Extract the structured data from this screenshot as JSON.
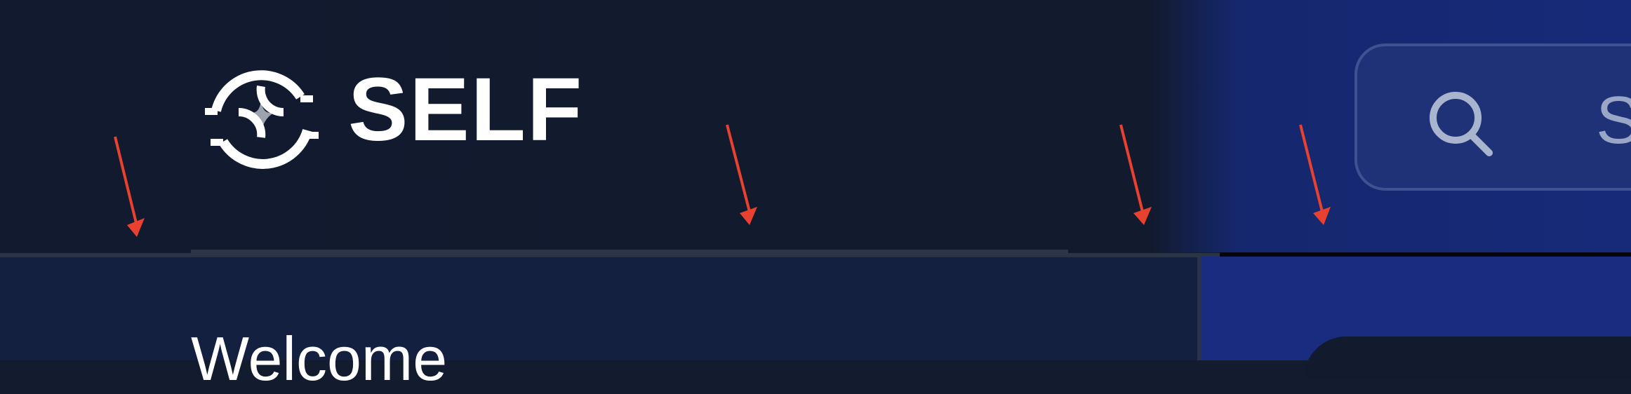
{
  "header": {
    "brand": "SELF",
    "search": {
      "placeholder": "S"
    }
  },
  "main": {
    "welcome": "Welcome"
  },
  "icons": {
    "logo": "self-logo-icon",
    "search": "search-icon"
  },
  "colors": {
    "header_bg": "#121a2e",
    "accent_blue": "#172a7a",
    "annotation_arrow": "#e8412f"
  }
}
